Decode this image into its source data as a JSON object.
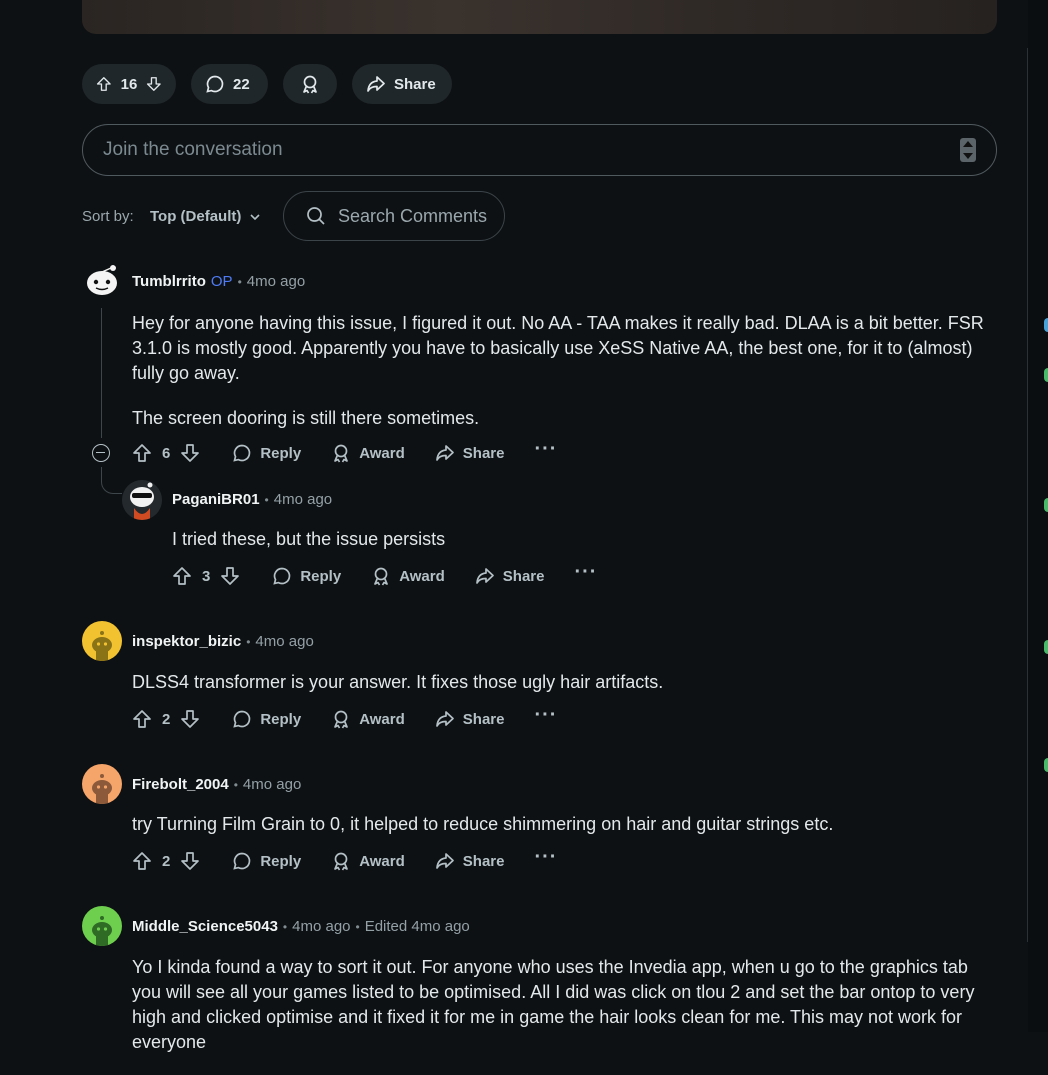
{
  "post_actions": {
    "upvotes": "16",
    "comments": "22",
    "share_label": "Share"
  },
  "composer": {
    "placeholder": "Join the conversation"
  },
  "sort": {
    "label": "Sort by:",
    "value": "Top (Default)",
    "search_placeholder": "Search Comments"
  },
  "actions": {
    "reply": "Reply",
    "award": "Award",
    "share": "Share",
    "more": "···"
  },
  "comments": [
    {
      "author": "Tumblrrito",
      "badge": "OP",
      "time": "4mo ago",
      "paragraphs": [
        "Hey for anyone having this issue, I figured it out. No AA - TAA makes it really bad. DLAA is a bit better. FSR 3.1.0 is mostly good. Apparently you have to basically use XeSS Native AA, the best one, for it to (almost) fully go away.",
        "The screen dooring is still there sometimes."
      ],
      "votes": "6"
    },
    {
      "author": "PaganiBR01",
      "time": "4mo ago",
      "paragraphs": [
        "I tried these, but the issue persists"
      ],
      "votes": "3"
    },
    {
      "author": "inspektor_bizic",
      "time": "4mo ago",
      "paragraphs": [
        "DLSS4 transformer is your answer. It fixes those ugly hair artifacts."
      ],
      "votes": "2"
    },
    {
      "author": "Firebolt_2004",
      "time": "4mo ago",
      "paragraphs": [
        "try Turning Film Grain to 0, it helped to reduce shimmering on hair and guitar strings etc."
      ],
      "votes": "2"
    },
    {
      "author": "Middle_Science5043",
      "time": "4mo ago",
      "edited": "Edited 4mo ago",
      "paragraphs": [
        "Yo I kinda found a way to sort it out. For anyone who uses the Invedia app, when u go to the graphics tab you will see all your games listed to be optimised. All I did was click on tlou 2 and set the bar ontop to very high and clicked optimise and it fixed it for me in game the hair looks clean for me. This may not work for everyone"
      ]
    }
  ],
  "colors": {
    "background": "#0e1113",
    "pill": "#1f272b",
    "op_badge": "#4f7cf6",
    "avatar_yellow": "#f2c230",
    "avatar_orange": "#f5a46a",
    "avatar_green": "#6ecf4f"
  }
}
